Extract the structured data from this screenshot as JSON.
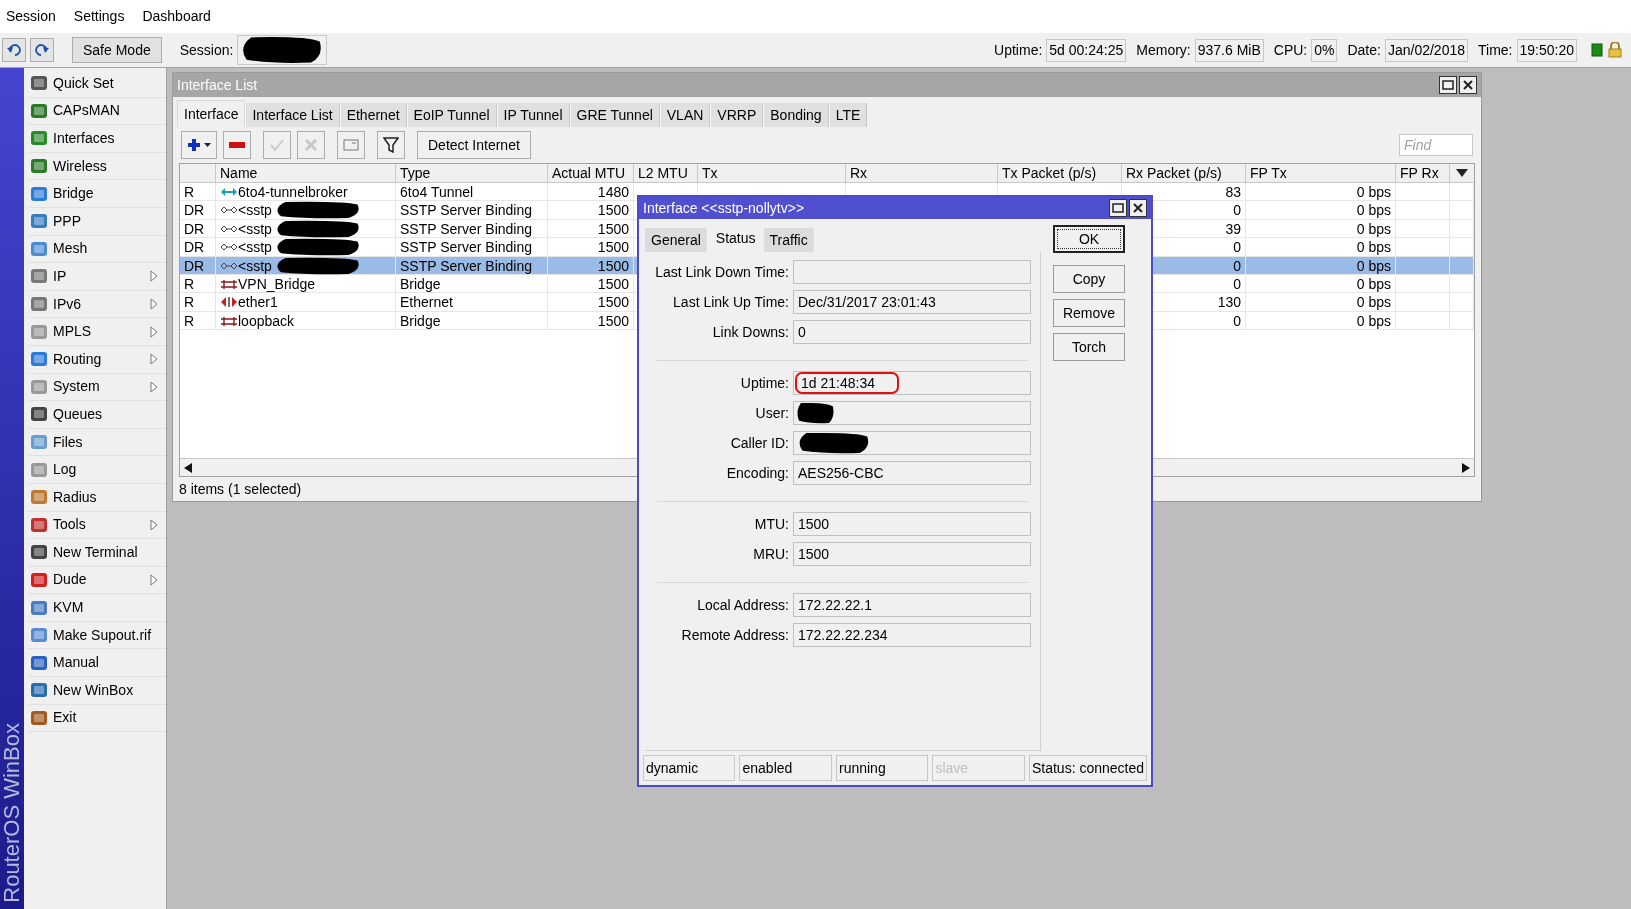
{
  "menu": [
    {
      "label": "Session"
    },
    {
      "label": "Settings"
    },
    {
      "label": "Dashboard"
    }
  ],
  "toolbar": {
    "safe_mode": "Safe Mode",
    "session_label": "Session:",
    "session_redacted": true,
    "stats": [
      {
        "label": "Uptime:",
        "value": "5d 00:24:25"
      },
      {
        "label": "Memory:",
        "value": "937.6 MiB"
      },
      {
        "label": "CPU:",
        "value": "0%"
      },
      {
        "label": "Date:",
        "value": "Jan/02/2018"
      },
      {
        "label": "Time:",
        "value": "19:50:20"
      }
    ]
  },
  "sidebar": {
    "brand": "RouterOS WinBox",
    "items": [
      {
        "label": "Quick Set",
        "submenu": false
      },
      {
        "label": "CAPsMAN",
        "submenu": false
      },
      {
        "label": "Interfaces",
        "submenu": false
      },
      {
        "label": "Wireless",
        "submenu": false
      },
      {
        "label": "Bridge",
        "submenu": false
      },
      {
        "label": "PPP",
        "submenu": false
      },
      {
        "label": "Mesh",
        "submenu": false
      },
      {
        "label": "IP",
        "submenu": true
      },
      {
        "label": "IPv6",
        "submenu": true
      },
      {
        "label": "MPLS",
        "submenu": true
      },
      {
        "label": "Routing",
        "submenu": true
      },
      {
        "label": "System",
        "submenu": true
      },
      {
        "label": "Queues",
        "submenu": false
      },
      {
        "label": "Files",
        "submenu": false
      },
      {
        "label": "Log",
        "submenu": false
      },
      {
        "label": "Radius",
        "submenu": false
      },
      {
        "label": "Tools",
        "submenu": true
      },
      {
        "label": "New Terminal",
        "submenu": false
      },
      {
        "label": "Dude",
        "submenu": true
      },
      {
        "label": "KVM",
        "submenu": false
      },
      {
        "label": "Make Supout.rif",
        "submenu": false
      },
      {
        "label": "Manual",
        "submenu": false
      },
      {
        "label": "New WinBox",
        "submenu": false
      },
      {
        "label": "Exit",
        "submenu": false
      }
    ]
  },
  "interface_list": {
    "title": "Interface List",
    "tabs": [
      {
        "label": "Interface",
        "selected": true
      },
      {
        "label": "Interface List",
        "selected": false
      },
      {
        "label": "Ethernet",
        "selected": false
      },
      {
        "label": "EoIP Tunnel",
        "selected": false
      },
      {
        "label": "IP Tunnel",
        "selected": false
      },
      {
        "label": "GRE Tunnel",
        "selected": false
      },
      {
        "label": "VLAN",
        "selected": false
      },
      {
        "label": "VRRP",
        "selected": false
      },
      {
        "label": "Bonding",
        "selected": false
      },
      {
        "label": "LTE",
        "selected": false
      }
    ],
    "detect_button": "Detect Internet",
    "find_placeholder": "Find",
    "columns": [
      "Name",
      "Type",
      "Actual MTU",
      "L2 MTU",
      "Tx",
      "Rx",
      "Tx Packet (p/s)",
      "Rx Packet (p/s)",
      "FP Tx",
      "FP Rx"
    ],
    "rows": [
      {
        "flags": "R",
        "kind": "tunnel",
        "name": "6to4-tunnelbroker",
        "type": "6to4 Tunnel",
        "actual_mtu": "1480",
        "rx_packet": "83",
        "fp_tx": "0 bps",
        "redacted": false,
        "selected": false
      },
      {
        "flags": "DR",
        "kind": "sstp",
        "name": "<sstp",
        "type": "SSTP Server Binding",
        "actual_mtu": "1500",
        "rx_packet": "0",
        "fp_tx": "0 bps",
        "redacted": true,
        "selected": false
      },
      {
        "flags": "DR",
        "kind": "sstp",
        "name": "<sstp",
        "type": "SSTP Server Binding",
        "actual_mtu": "1500",
        "rx_packet": "39",
        "fp_tx": "0 bps",
        "redacted": true,
        "selected": false
      },
      {
        "flags": "DR",
        "kind": "sstp",
        "name": "<sstp",
        "type": "SSTP Server Binding",
        "actual_mtu": "1500",
        "rx_packet": "0",
        "fp_tx": "0 bps",
        "redacted": true,
        "selected": false
      },
      {
        "flags": "DR",
        "kind": "sstp",
        "name": "<sstp",
        "type": "SSTP Server Binding",
        "actual_mtu": "1500",
        "rx_packet": "0",
        "fp_tx": "0 bps",
        "redacted": true,
        "selected": true
      },
      {
        "flags": "R",
        "kind": "bridge",
        "name": "VPN_Bridge",
        "type": "Bridge",
        "actual_mtu": "1500",
        "rx_packet": "0",
        "fp_tx": "0 bps",
        "redacted": false,
        "selected": false
      },
      {
        "flags": "R",
        "kind": "ethernet",
        "name": "ether1",
        "type": "Ethernet",
        "actual_mtu": "1500",
        "rx_packet": "130",
        "fp_tx": "0 bps",
        "redacted": false,
        "selected": false
      },
      {
        "flags": "R",
        "kind": "bridge",
        "name": "loopback",
        "type": "Bridge",
        "actual_mtu": "1500",
        "rx_packet": "0",
        "fp_tx": "0 bps",
        "redacted": false,
        "selected": false
      }
    ],
    "status": "8 items (1 selected)"
  },
  "dialog": {
    "title": "Interface <<sstp-nollytv>>",
    "tabs": [
      {
        "label": "General",
        "selected": false
      },
      {
        "label": "Status",
        "selected": true
      },
      {
        "label": "Traffic",
        "selected": false
      }
    ],
    "buttons": [
      {
        "label": "OK",
        "default": true
      },
      {
        "label": "Copy",
        "default": false
      },
      {
        "label": "Remove",
        "default": false
      },
      {
        "label": "Torch",
        "default": false
      }
    ],
    "field_groups": [
      [
        {
          "label": "Last Link Down Time:",
          "highlighted": false,
          "redacted": false
        },
        {
          "label": "Last Link Up Time:",
          "value": "Dec/31/2017 23:01:43",
          "highlighted": false,
          "redacted": false
        },
        {
          "label": "Link Downs:",
          "value": "0",
          "highlighted": false,
          "redacted": false
        }
      ],
      [
        {
          "label": "Uptime:",
          "value": "1d 21:48:34",
          "highlighted": true,
          "redacted": false
        },
        {
          "label": "User:",
          "highlighted": false,
          "redacted": true
        },
        {
          "label": "Caller ID:",
          "highlighted": false,
          "redacted": true
        },
        {
          "label": "Encoding:",
          "value": "AES256-CBC",
          "highlighted": false,
          "redacted": false
        }
      ],
      [
        {
          "label": "MTU:",
          "value": "1500",
          "highlighted": false,
          "redacted": false
        },
        {
          "label": "MRU:",
          "value": "1500",
          "highlighted": false,
          "redacted": false
        }
      ],
      [
        {
          "label": "Local Address:",
          "value": "172.22.22.1",
          "highlighted": false,
          "redacted": false
        },
        {
          "label": "Remote Address:",
          "value": "172.22.22.234",
          "highlighted": false,
          "redacted": false
        }
      ]
    ],
    "status_cells": [
      {
        "text": "dynamic",
        "disabled": false
      },
      {
        "text": "enabled",
        "disabled": false
      },
      {
        "text": "running",
        "disabled": false
      },
      {
        "text": "slave",
        "disabled": true
      },
      {
        "text": "Status: connected",
        "disabled": false
      }
    ]
  }
}
